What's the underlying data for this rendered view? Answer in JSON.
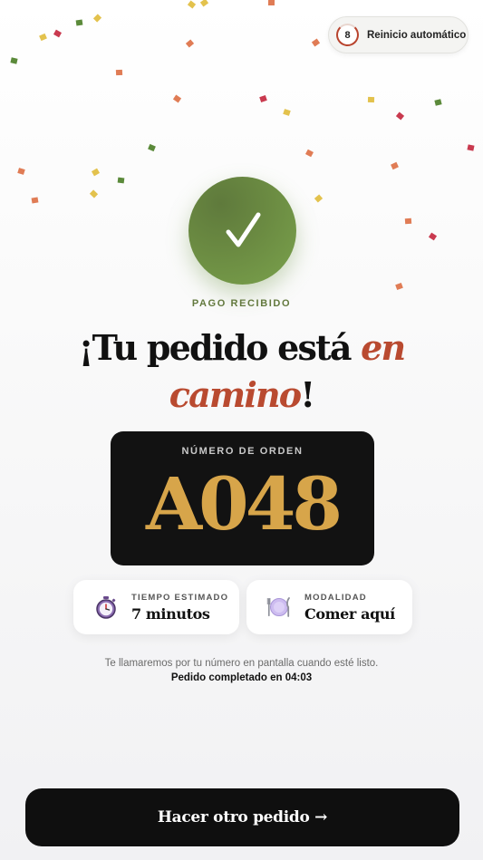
{
  "auto_restart": {
    "countdown": "8",
    "label": "Reinicio automático"
  },
  "status": {
    "eyebrow": "PAGO RECIBIDO"
  },
  "headline": {
    "part1": "¡Tu pedido está ",
    "accent1": "en",
    "accent2": "camino",
    "end": "!"
  },
  "order": {
    "label": "NÚMERO DE ORDEN",
    "number": "A048"
  },
  "estimated_time": {
    "label": "TIEMPO ESTIMADO",
    "value": "7 minutos",
    "icon": "stopwatch-icon"
  },
  "mode": {
    "label": "MODALIDAD",
    "value": "Comer aquí",
    "icon": "plate-cutlery-icon"
  },
  "note": "Te llamaremos por tu número en pantalla cuando esté listo.",
  "completed": "Pedido completado en 04:03",
  "cta": {
    "label": "Hacer otro pedido →"
  },
  "colors": {
    "accent_red": "#b94a30",
    "success_green": "#6b8b42",
    "gold": "#d7a54a",
    "dark": "#121212",
    "confetti": [
      "#c93a4f",
      "#e3c24d",
      "#e07c55",
      "#5b8a3a"
    ]
  }
}
